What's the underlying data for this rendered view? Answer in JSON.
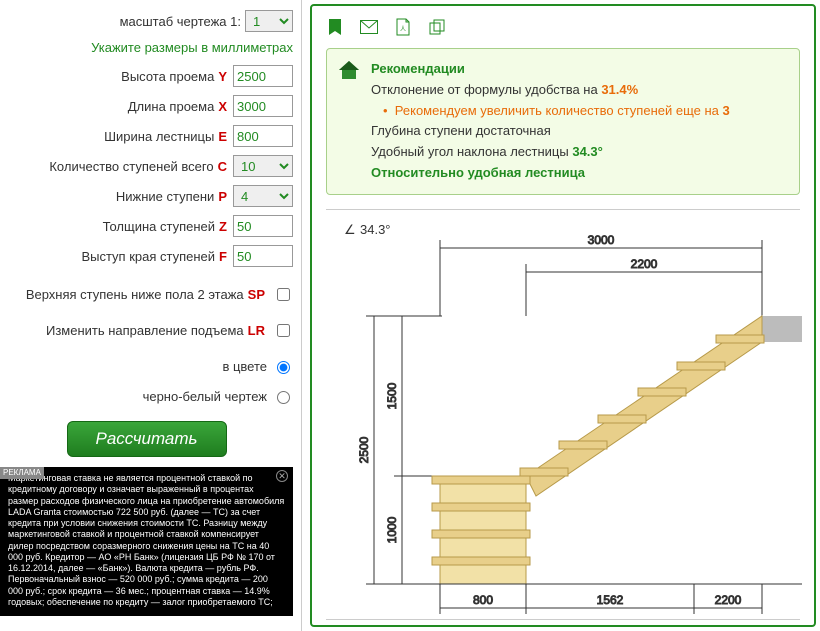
{
  "form": {
    "scale_label": "масштаб чертежа 1:",
    "scale_value": "1",
    "units_note": "Укажите размеры в миллиметрах",
    "fields": [
      {
        "label": "Высота проема",
        "letter": "Y",
        "value": "2500",
        "type": "text"
      },
      {
        "label": "Длина проема",
        "letter": "X",
        "value": "3000",
        "type": "text"
      },
      {
        "label": "Ширина лестницы",
        "letter": "E",
        "value": "800",
        "type": "text"
      },
      {
        "label": "Количество ступеней всего",
        "letter": "C",
        "value": "10",
        "type": "select"
      },
      {
        "label": "Нижние ступени",
        "letter": "P",
        "value": "4",
        "type": "select"
      },
      {
        "label": "Толщина ступеней",
        "letter": "Z",
        "value": "50",
        "type": "text"
      },
      {
        "label": "Выступ края ступеней",
        "letter": "F",
        "value": "50",
        "type": "text"
      }
    ],
    "check1": "Верхняя ступень ниже пола 2 этажа",
    "check1_letter": "SP",
    "check2": "Изменить направление подъема",
    "check2_letter": "LR",
    "radio1": "в цвете",
    "radio2": "черно-белый чертеж",
    "calc_button": "Рассчитать"
  },
  "ad": {
    "tag": "РЕКЛАМА",
    "text": "Маркетинговая ставка не является процентной ставкой по кредитному договору и означает выраженный в процентах размер расходов физического лица на приобретение автомобиля LADA Granta стоимостью 722 500 руб. (далее — ТС) за счет кредита при условии снижения стоимости ТС. Разницу между маркетинговой ставкой и процентной ставкой компенсирует дилер посредством соразмерного снижения цены на ТС на 40 000 руб. Кредитор — АО «РН Банк» (лицензия ЦБ РФ № 170 от 16.12.2014, далее — «Банк»). Валюта кредита — рубль РФ. Первоначальный взнос — 520 000 руб.; сумма кредита — 200 000 руб.; срок кредита — 36 мес.; процентная ставка — 14.9% годовых; обеспечение по кредиту — залог приобретаемого ТС;"
  },
  "reco": {
    "title": "Рекомендации",
    "line1_a": "Отклонение от формулы удобства на ",
    "line1_b": "31.4%",
    "line2_a": "Рекомендуем увеличить количество ступеней еще на ",
    "line2_b": "3",
    "line3": "Глубина ступени достаточная",
    "line4_a": "Удобный угол наклона лестницы ",
    "line4_b": "34.3°",
    "line5": "Относительно удобная лестница"
  },
  "chart_data": {
    "type": "diagram",
    "angle": "34.3°",
    "dims": {
      "total_width": 3000,
      "upper_run": 2200,
      "lower_run": 800,
      "total_height": 2500,
      "upper_height": 1500,
      "lower_height": 1000,
      "bottom_dims": [
        800,
        1562,
        2200
      ]
    }
  }
}
